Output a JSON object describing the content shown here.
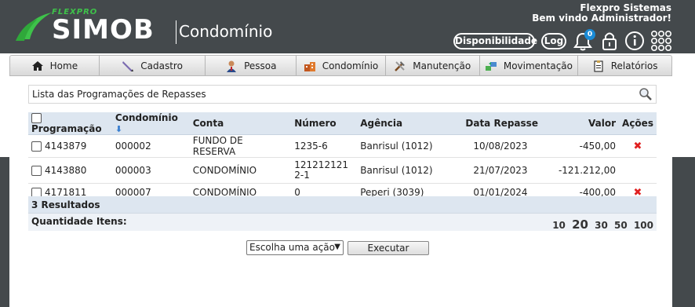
{
  "header": {
    "logo_brand": "FLEXPRO",
    "logo_product": "SIMOB",
    "logo_module": "Condomínio",
    "company": "Flexpro Sistemas",
    "welcome": "Bem vindo Administrador!",
    "availability_label": "Disponibilidade",
    "log_label": "Log",
    "notification_count": "0",
    "colors": {
      "background": "#44494c",
      "brand_green": "#3ec24a",
      "badge": "#1a8bd6"
    },
    "icons": [
      "bell-icon",
      "lock-icon",
      "info-icon",
      "apps-grid-icon"
    ]
  },
  "nav": {
    "items": [
      {
        "label": "Home",
        "icon": "home-icon"
      },
      {
        "label": "Cadastro",
        "icon": "pen-icon"
      },
      {
        "label": "Pessoa",
        "icon": "person-icon"
      },
      {
        "label": "Condomínio",
        "icon": "buildings-icon"
      },
      {
        "label": "Manutenção",
        "icon": "tools-icon"
      },
      {
        "label": "Movimentação",
        "icon": "transfer-icon"
      },
      {
        "label": "Relatórios",
        "icon": "report-icon"
      }
    ]
  },
  "main": {
    "list_title": "Lista das Programações de Repasses",
    "columns": [
      "Programação",
      "Condomínio",
      "Conta",
      "Número",
      "Agência",
      "Data Repasse",
      "Valor",
      "Ações"
    ],
    "rows": [
      {
        "programacao": "4143879",
        "condominio": "000002",
        "conta": "FUNDO DE RESERVA",
        "numero": "1235-6",
        "agencia": "Banrisul (1012)",
        "data": "10/08/2023",
        "valor": "-450,00",
        "delete": "✖"
      },
      {
        "programacao": "4143880",
        "condominio": "000003",
        "conta": "CONDOMÍNIO",
        "numero": "1212121212-1",
        "agencia": "Banrisul (1012)",
        "data": "21/07/2023",
        "valor": "-121.212,00",
        "delete": ""
      },
      {
        "programacao": "4171811",
        "condominio": "000007",
        "conta": "CONDOMÍNIO",
        "numero": "0",
        "agencia": "Peperi (3039)",
        "data": "01/01/2024",
        "valor": "-400,00",
        "delete": "✖"
      }
    ],
    "results_label": "3 Resultados",
    "quantity_label": "Quantidade Itens:",
    "page_sizes": [
      "10",
      "20",
      "30",
      "50",
      "100"
    ],
    "page_size_selected": "20",
    "action_select": "Escolha uma ação",
    "execute_label": "Executar"
  }
}
